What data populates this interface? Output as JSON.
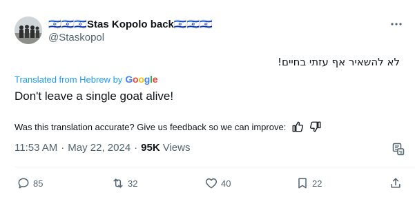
{
  "author": {
    "display_name": "🇮🇱🇮🇱🇮🇱Stas Kopolo back🇮🇱🇮🇱🇮🇱",
    "handle": "@Staskopol"
  },
  "post": {
    "text": "לא להשאיר אף עזתי בחיים!",
    "translated_label": "Translated from Hebrew by",
    "translation_provider": "Google",
    "translation": "Don't leave a single goat alive!",
    "feedback_prompt": "Was this translation accurate? Give us feedback so we can improve:",
    "time": "11:53 AM",
    "date": "May 22, 2024",
    "separator": "·",
    "views_count": "95K",
    "views_label": "Views"
  },
  "actions": {
    "replies": "85",
    "reposts": "32",
    "likes": "40",
    "bookmarks": "22"
  },
  "colors": {
    "link": "#1d9bf0",
    "secondary_text": "#536471",
    "primary_text": "#0f1419"
  }
}
